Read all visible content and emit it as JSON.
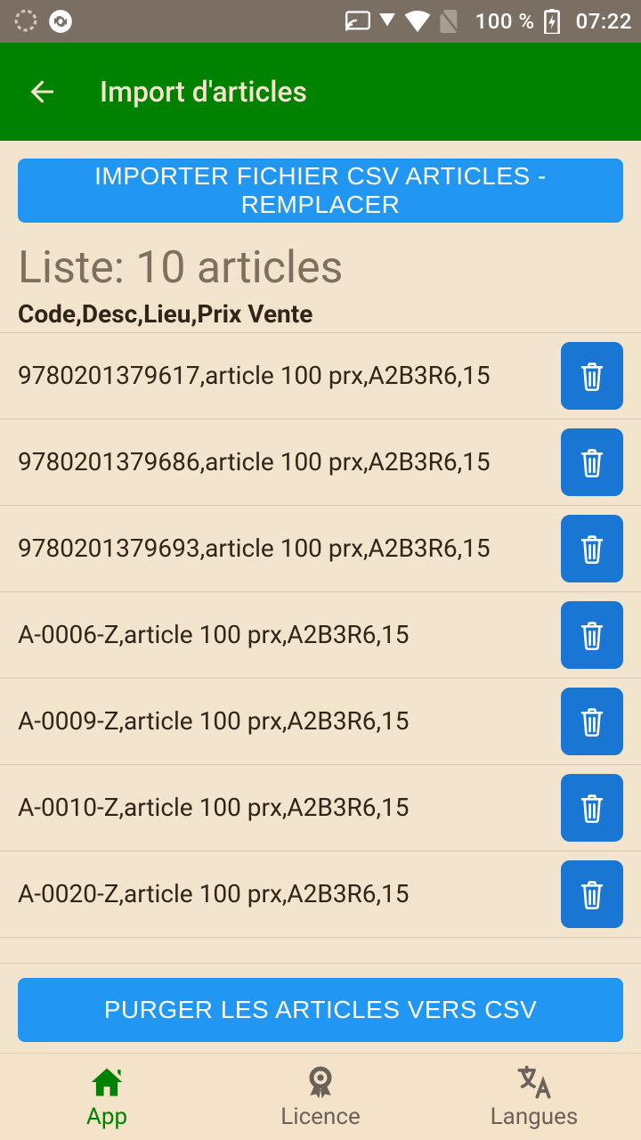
{
  "status": {
    "battery_text": "100 %",
    "time": "07:22"
  },
  "appBar": {
    "title": "Import d'articles"
  },
  "buttons": {
    "import_csv": "IMPORTER FICHIER CSV ARTICLES - REMPLACER",
    "purge_csv": "PURGER LES ARTICLES VERS CSV"
  },
  "list_title": "Liste: 10 articles",
  "columns_header": "Code,Desc,Lieu,Prix Vente",
  "rows": [
    "9780201379617,article 100 prx,A2B3R6,15",
    "9780201379686,article 100 prx,A2B3R6,15",
    "9780201379693,article 100 prx,A2B3R6,15",
    "A-0006-Z,article 100 prx,A2B3R6,15",
    "A-0009-Z,article 100 prx,A2B3R6,15",
    "A-0010-Z,article 100 prx,A2B3R6,15",
    "A-0020-Z,article 100 prx,A2B3R6,15"
  ],
  "nav": {
    "app": "App",
    "licence": "Licence",
    "langues": "Langues"
  }
}
